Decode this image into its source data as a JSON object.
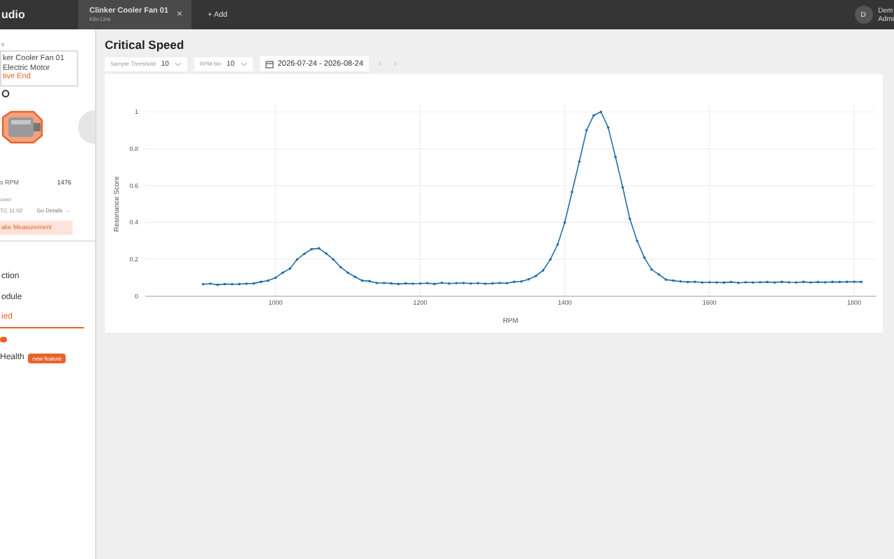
{
  "top_bar": {
    "brand": "udio",
    "tabs": [
      {
        "title": "Clinker Cooler Fan 01",
        "subtitle": "Kiln Line",
        "close": "×",
        "selected": true
      }
    ],
    "add_button": "+ Add",
    "user": {
      "avatar": "D",
      "name": "Dem",
      "role": "Admi"
    }
  },
  "sidebar": {
    "section_label": "e",
    "asset": {
      "name": "ker Cooler Fan 01",
      "type": "Electric Motor",
      "location": "tive End"
    },
    "stats": [
      {
        "label": "s RPM",
        "value": "1476"
      }
    ],
    "last_label": "ower",
    "last_time": "TC 11:02",
    "details_link": "Go Details →",
    "measure_button": "ake Measurement",
    "nav": [
      {
        "label": "ction",
        "selected": false
      },
      {
        "label": "odule",
        "selected": false
      },
      {
        "label": "ied",
        "selected": true
      }
    ],
    "health": {
      "label": "Health",
      "badge": "new feature"
    }
  },
  "main": {
    "title": "Critical Speed",
    "filters": [
      {
        "label": "Sample Threshold",
        "value": "10"
      },
      {
        "label": "RPM bin",
        "value": "10"
      }
    ],
    "date_range": "2026-07-24 - 2026-08-24",
    "prev": "‹",
    "next": "›",
    "chart_data": {
      "type": "line",
      "xlabel": "RPM",
      "ylabel": "Resonance Score",
      "xlim": [
        820,
        1830
      ],
      "ylim": [
        0,
        1
      ],
      "grid": true,
      "xticks": [
        1000,
        1200,
        1400,
        1600,
        1800
      ],
      "yticks": [
        {
          "value": 0,
          "label": "0"
        },
        {
          "value": 0.2,
          "label": "0.2"
        },
        {
          "value": 0.4,
          "label": "0.4"
        },
        {
          "value": 0.6,
          "label": "0.6"
        },
        {
          "value": 0.8,
          "label": "0.8"
        },
        {
          "value": 1,
          "label": "1"
        }
      ],
      "x": [
        900,
        910,
        920,
        930,
        940,
        950,
        960,
        970,
        980,
        990,
        1000,
        1010,
        1020,
        1030,
        1040,
        1050,
        1060,
        1070,
        1080,
        1090,
        1100,
        1110,
        1120,
        1130,
        1140,
        1150,
        1160,
        1170,
        1180,
        1190,
        1200,
        1210,
        1220,
        1230,
        1240,
        1250,
        1260,
        1270,
        1280,
        1290,
        1300,
        1310,
        1320,
        1330,
        1340,
        1350,
        1360,
        1370,
        1380,
        1390,
        1400,
        1410,
        1420,
        1430,
        1440,
        1450,
        1460,
        1470,
        1480,
        1490,
        1500,
        1510,
        1520,
        1530,
        1540,
        1550,
        1560,
        1570,
        1580,
        1590,
        1600,
        1610,
        1620,
        1630,
        1640,
        1650,
        1660,
        1670,
        1680,
        1690,
        1700,
        1710,
        1720,
        1730,
        1740,
        1750,
        1760,
        1770,
        1780,
        1790,
        1800,
        1810
      ],
      "series": [
        {
          "color": "#1f6fa8",
          "values": [
            0.065,
            0.068,
            0.062,
            0.066,
            0.065,
            0.066,
            0.068,
            0.07,
            0.078,
            0.085,
            0.1,
            0.128,
            0.15,
            0.2,
            0.23,
            0.255,
            0.26,
            0.232,
            0.2,
            0.158,
            0.128,
            0.105,
            0.085,
            0.082,
            0.072,
            0.072,
            0.07,
            0.067,
            0.07,
            0.068,
            0.069,
            0.071,
            0.067,
            0.073,
            0.069,
            0.071,
            0.072,
            0.069,
            0.071,
            0.068,
            0.07,
            0.072,
            0.071,
            0.078,
            0.08,
            0.092,
            0.11,
            0.14,
            0.2,
            0.28,
            0.4,
            0.565,
            0.73,
            0.9,
            0.98,
            1.0,
            0.915,
            0.755,
            0.59,
            0.42,
            0.3,
            0.21,
            0.145,
            0.118,
            0.09,
            0.085,
            0.08,
            0.077,
            0.079,
            0.075,
            0.076,
            0.075,
            0.074,
            0.077,
            0.073,
            0.076,
            0.075,
            0.076,
            0.077,
            0.075,
            0.078,
            0.076,
            0.075,
            0.078,
            0.075,
            0.077,
            0.076,
            0.078,
            0.077,
            0.078,
            0.079,
            0.078
          ]
        }
      ]
    }
  }
}
